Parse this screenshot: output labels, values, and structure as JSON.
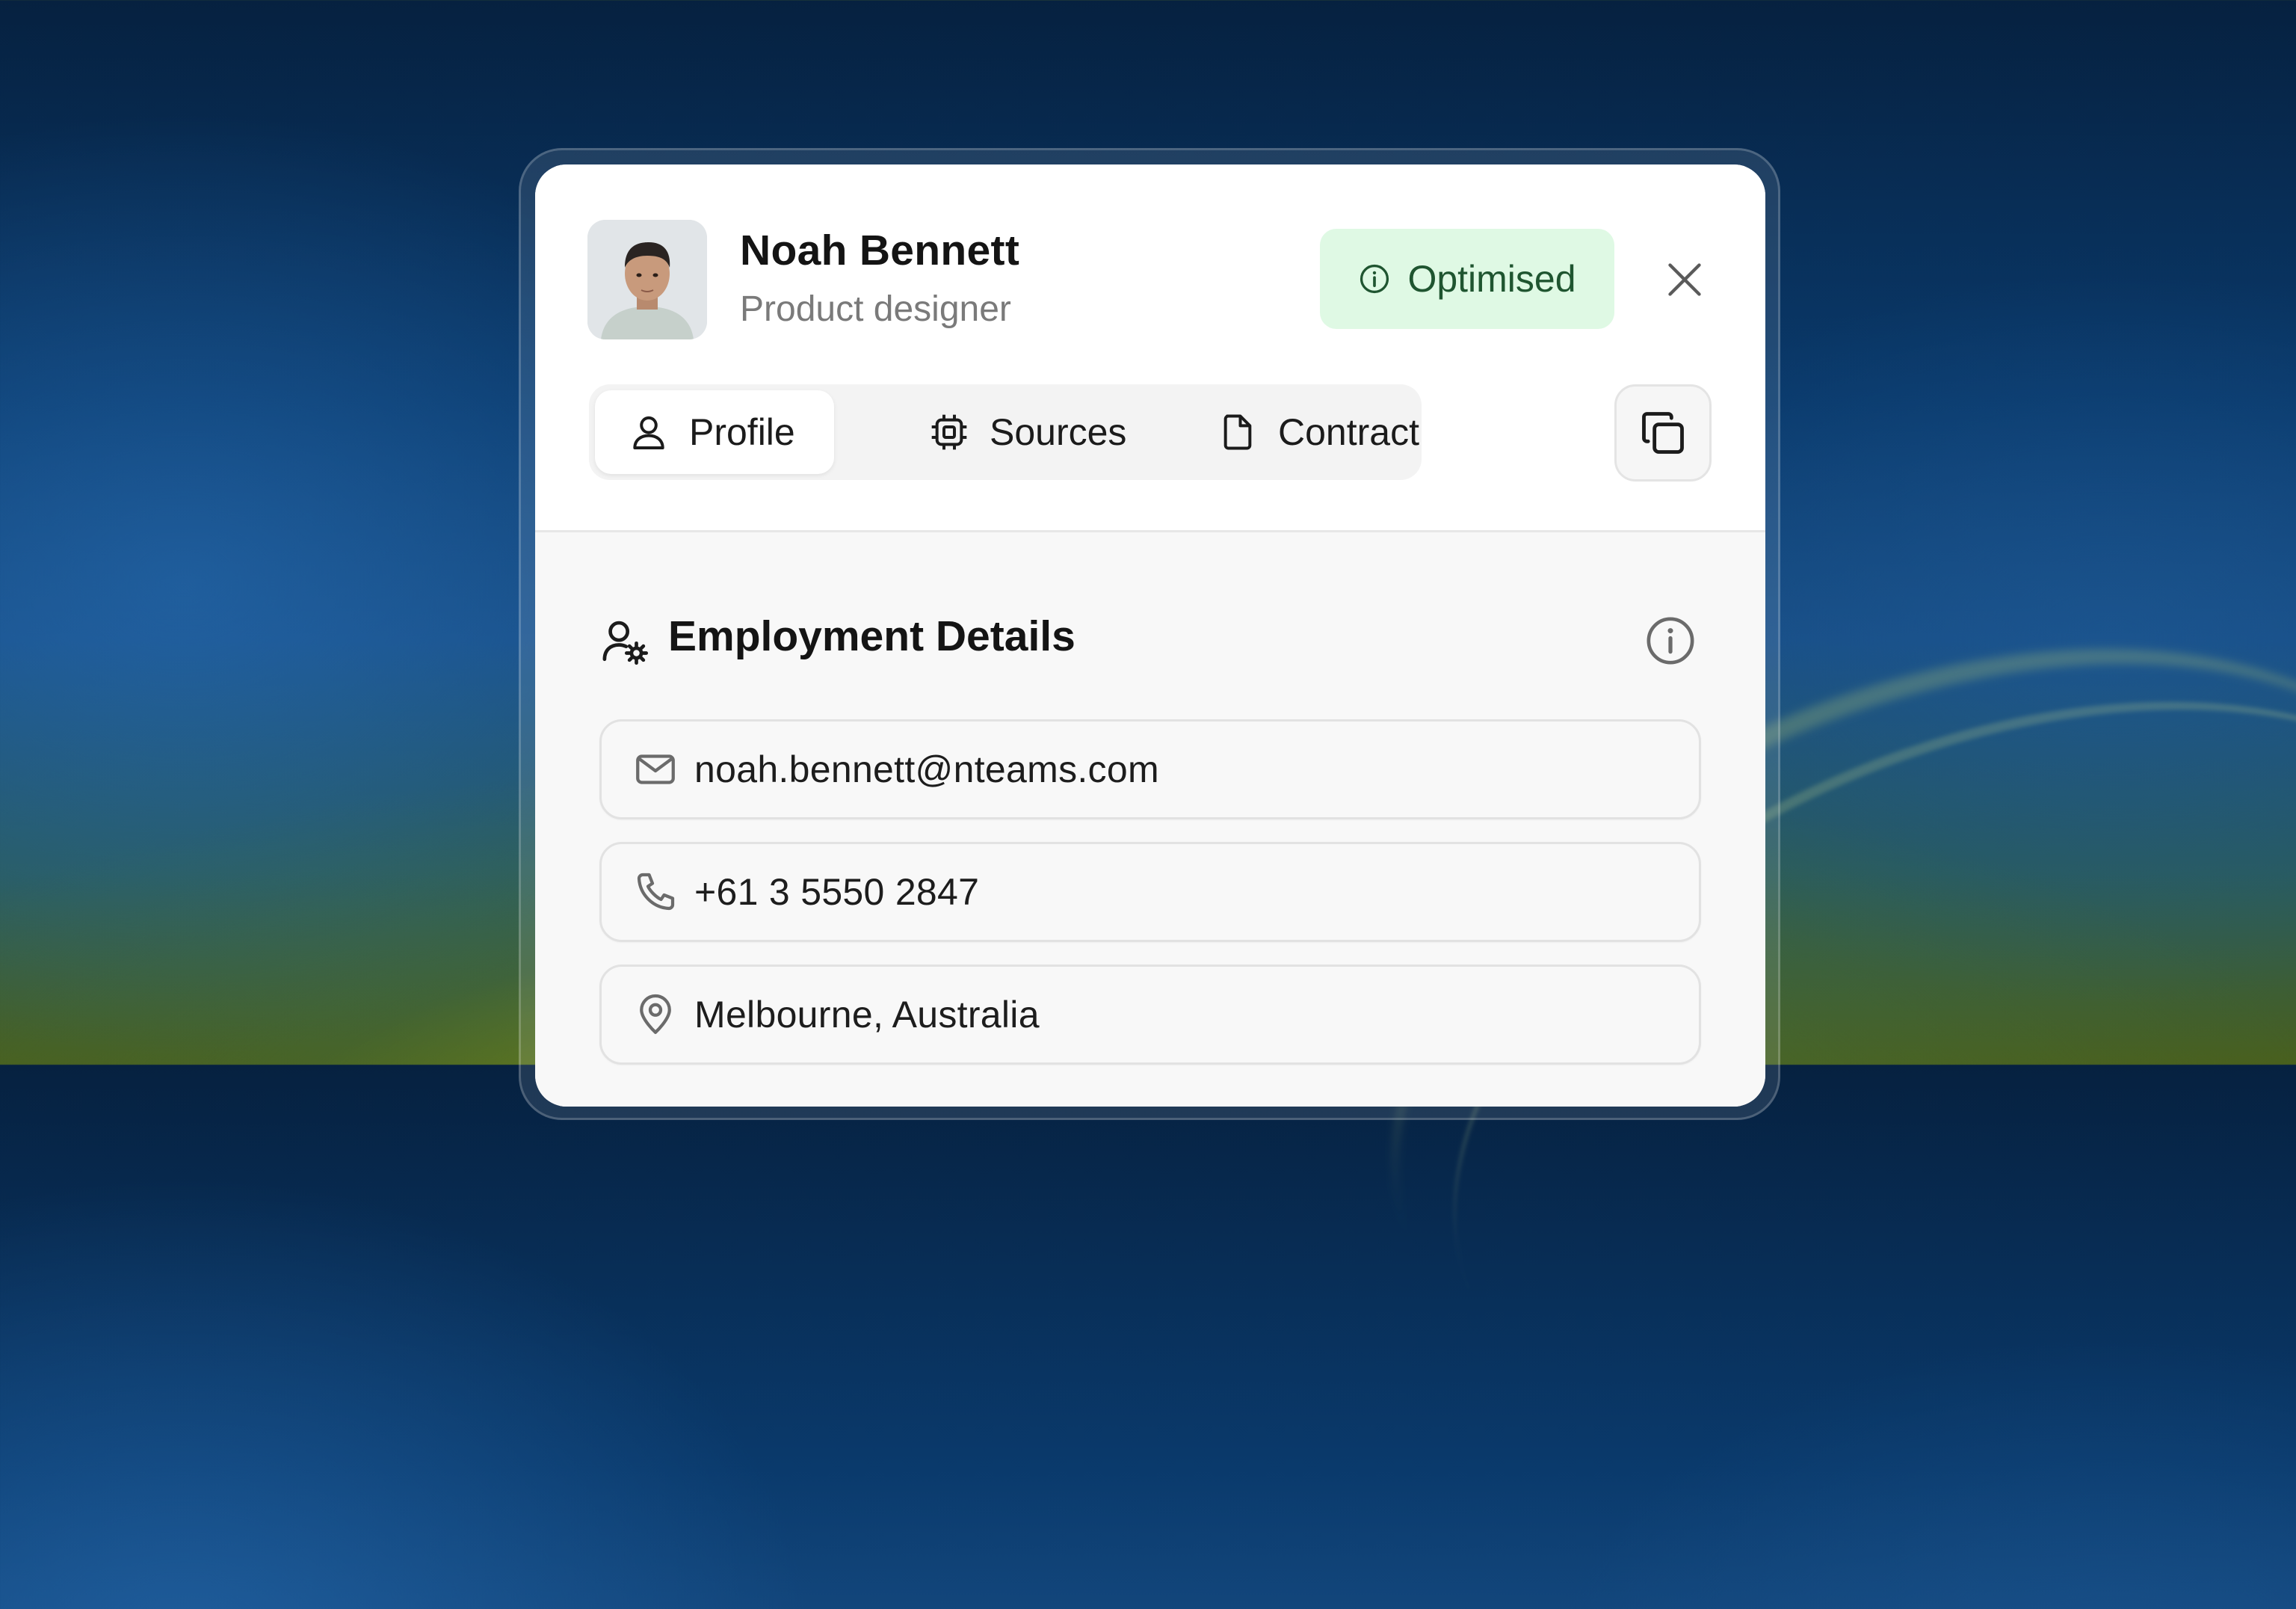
{
  "profile": {
    "name": "Noah Bennett",
    "role": "Product designer",
    "badge": "Optimised"
  },
  "tabs": [
    {
      "label": "Profile",
      "icon": "user-icon",
      "active": true
    },
    {
      "label": "Sources",
      "icon": "chip-icon",
      "active": false
    },
    {
      "label": "Contract",
      "icon": "file-icon",
      "active": false
    }
  ],
  "section": {
    "title": "Employment Details"
  },
  "fields": [
    {
      "value": "noah.bennett@nteams.com",
      "icon": "mail-icon"
    },
    {
      "value": "+61 3 5550 2847",
      "icon": "phone-icon"
    },
    {
      "value": "Melbourne, Australia",
      "icon": "map-pin-icon"
    }
  ],
  "colors": {
    "badge_bg": "#dff9e4",
    "badge_text": "#1f5530",
    "card_bg": "#ffffff",
    "body_bg": "#f8f8f8"
  }
}
